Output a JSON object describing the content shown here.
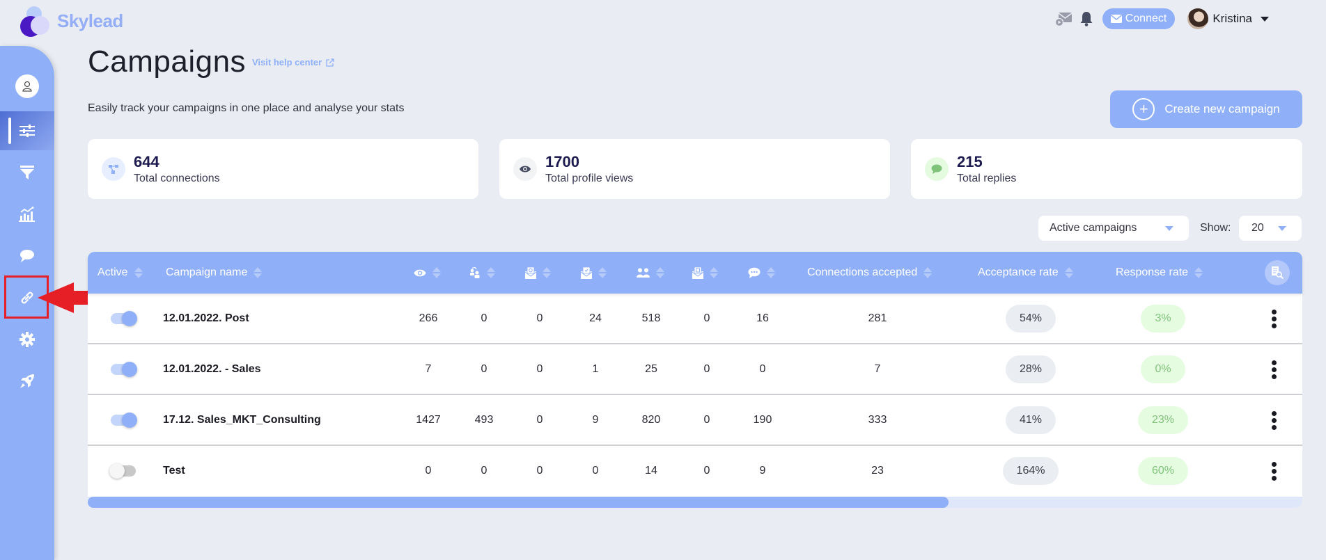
{
  "app": {
    "name": "Skylead"
  },
  "topbar": {
    "connect_label": "Connect",
    "user_name": "Kristina"
  },
  "sidebar": {
    "items": [
      {
        "name": "profile",
        "icon": "user-icon"
      },
      {
        "name": "campaigns",
        "icon": "sliders-icon",
        "active": true
      },
      {
        "name": "filter",
        "icon": "funnel-icon"
      },
      {
        "name": "statistics",
        "icon": "chart-icon"
      },
      {
        "name": "inbox",
        "icon": "chat-bubble-icon"
      },
      {
        "name": "integrations",
        "icon": "link-icon",
        "highlighted": true
      },
      {
        "name": "settings",
        "icon": "gear-icon"
      },
      {
        "name": "onboarding",
        "icon": "rocket-icon"
      }
    ]
  },
  "page": {
    "title": "Campaigns",
    "help_link": "Visit help center",
    "subtitle": "Easily track your campaigns in one place and analyse your stats",
    "create_button": "Create new campaign"
  },
  "stats": [
    {
      "value": "644",
      "label": "Total connections",
      "icon": "network-icon"
    },
    {
      "value": "1700",
      "label": "Total profile views",
      "icon": "eye-icon"
    },
    {
      "value": "215",
      "label": "Total replies",
      "icon": "chat-bubble-icon"
    }
  ],
  "filters": {
    "campaign_filter": "Active campaigns",
    "show_label": "Show:",
    "show_value": "20"
  },
  "table": {
    "columns": [
      {
        "label": "Active"
      },
      {
        "label": "Campaign name"
      },
      {
        "icon": "eye-icon",
        "meaning": "Profile views"
      },
      {
        "icon": "follow-icon",
        "meaning": "Follows"
      },
      {
        "icon": "email-icon",
        "meaning": "Emails"
      },
      {
        "icon": "email-check-icon",
        "meaning": "Email verified"
      },
      {
        "icon": "people-icon",
        "meaning": "Connection requests"
      },
      {
        "icon": "inmail-icon",
        "meaning": "InMails"
      },
      {
        "icon": "message-icon",
        "meaning": "Messages"
      },
      {
        "label": "Connections accepted"
      },
      {
        "label": "Acceptance rate"
      },
      {
        "label": "Response rate"
      }
    ],
    "rows": [
      {
        "active": true,
        "name": "12.01.2022. Post",
        "c1": "266",
        "c2": "0",
        "c3": "0",
        "c4": "24",
        "c5": "518",
        "c6": "0",
        "c7": "16",
        "accepted": "281",
        "acceptance_rate": "54%",
        "response_rate": "3%"
      },
      {
        "active": true,
        "name": "12.01.2022. - Sales",
        "c1": "7",
        "c2": "0",
        "c3": "0",
        "c4": "1",
        "c5": "25",
        "c6": "0",
        "c7": "0",
        "accepted": "7",
        "acceptance_rate": "28%",
        "response_rate": "0%"
      },
      {
        "active": true,
        "name": "17.12. Sales_MKT_Consulting",
        "c1": "1427",
        "c2": "493",
        "c3": "0",
        "c4": "9",
        "c5": "820",
        "c6": "0",
        "c7": "190",
        "accepted": "333",
        "acceptance_rate": "41%",
        "response_rate": "23%"
      },
      {
        "active": false,
        "name": "Test",
        "c1": "0",
        "c2": "0",
        "c3": "0",
        "c4": "0",
        "c5": "14",
        "c6": "0",
        "c7": "9",
        "accepted": "23",
        "acceptance_rate": "164%",
        "response_rate": "60%"
      }
    ]
  },
  "colors": {
    "accent": "#8fb0f8",
    "background": "#e9edf3",
    "logo_dark": "#4a19c4",
    "response_green": "#7fc27a",
    "highlight_red": "#e61e25"
  }
}
